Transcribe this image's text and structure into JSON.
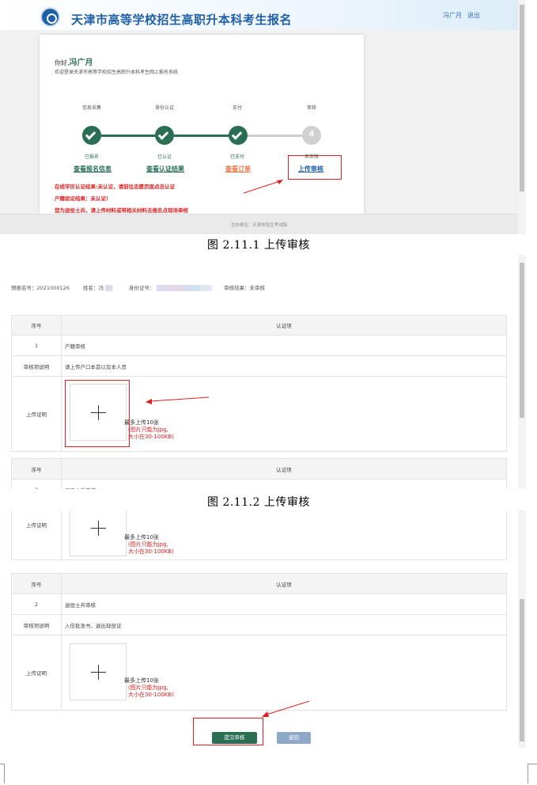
{
  "colors": {
    "green": "#2a6e54",
    "blue": "#1f5fa6",
    "red": "#e02020",
    "orange": "#e8744a"
  },
  "shot1": {
    "site_title": "天津市高等学校招生高职升本科考生报名",
    "user_name": "冯广月",
    "logout": "退出",
    "greeting_prefix": "你好,",
    "greeting_name": "冯广月",
    "welcome": "欢迎登录天津市高等学校招生高职升本科考生网上报名系统",
    "steps": [
      {
        "title": "信息采集",
        "status": "已报名",
        "link": "查看报名信息",
        "done": true
      },
      {
        "title": "身份认证",
        "status": "已认证",
        "link": "查看认证结果",
        "done": true
      },
      {
        "title": "支付",
        "status": "已支付",
        "link": "查看订单",
        "done": true
      },
      {
        "title": "审核",
        "status": "未审核",
        "link": "上传审核",
        "done": false,
        "number": "4"
      }
    ],
    "warnings": [
      "在线学历认证结果:未认证，请前往志愿页面点击认证",
      "户籍验证结果：未认证！",
      "您为退役士兵，请上传材料或带相关材料去报名点现场审核"
    ],
    "footer": "主办单位：天津市招生考试院",
    "icon": "check-icon"
  },
  "caption1": "图 2.11.1 上传审核",
  "shot2": {
    "reg_no_label": "预报名号：2021000126",
    "name_label": "姓名：冯",
    "id_label": "身份证号：",
    "result_label": "审核结果：",
    "result_value": "未审核",
    "table": {
      "col1": "序号",
      "col2": "认证项",
      "rows": [
        {
          "label": "1",
          "value": "户籍审核"
        },
        {
          "label": "审核项说明",
          "value": "请上传户口本首以及本人页"
        },
        {
          "label": "上传证明",
          "value": ""
        }
      ],
      "row2_no": "2",
      "row2_value": "退役士兵审核"
    },
    "upload": {
      "hint1": "最多上传10张",
      "hint2": "(图片只能为jpg,",
      "hint3": "大小在30-100KB)"
    }
  },
  "caption2": "图 2.11.2 上传审核",
  "shot3": {
    "upload_label": "上传证明",
    "table": {
      "col1": "序号",
      "col2": "认证项",
      "rows": [
        {
          "label": "2",
          "value": "退役士兵审核"
        },
        {
          "label": "审核项说明",
          "value": "入伍批准书，退出现役证"
        },
        {
          "label": "上传证明",
          "value": ""
        }
      ]
    },
    "upload": {
      "hint1": "最多上传10张",
      "hint2": "(图片只能为jpg,",
      "hint3": "大小在30-100KB)"
    },
    "submit": "提交审核",
    "back": "返回"
  }
}
